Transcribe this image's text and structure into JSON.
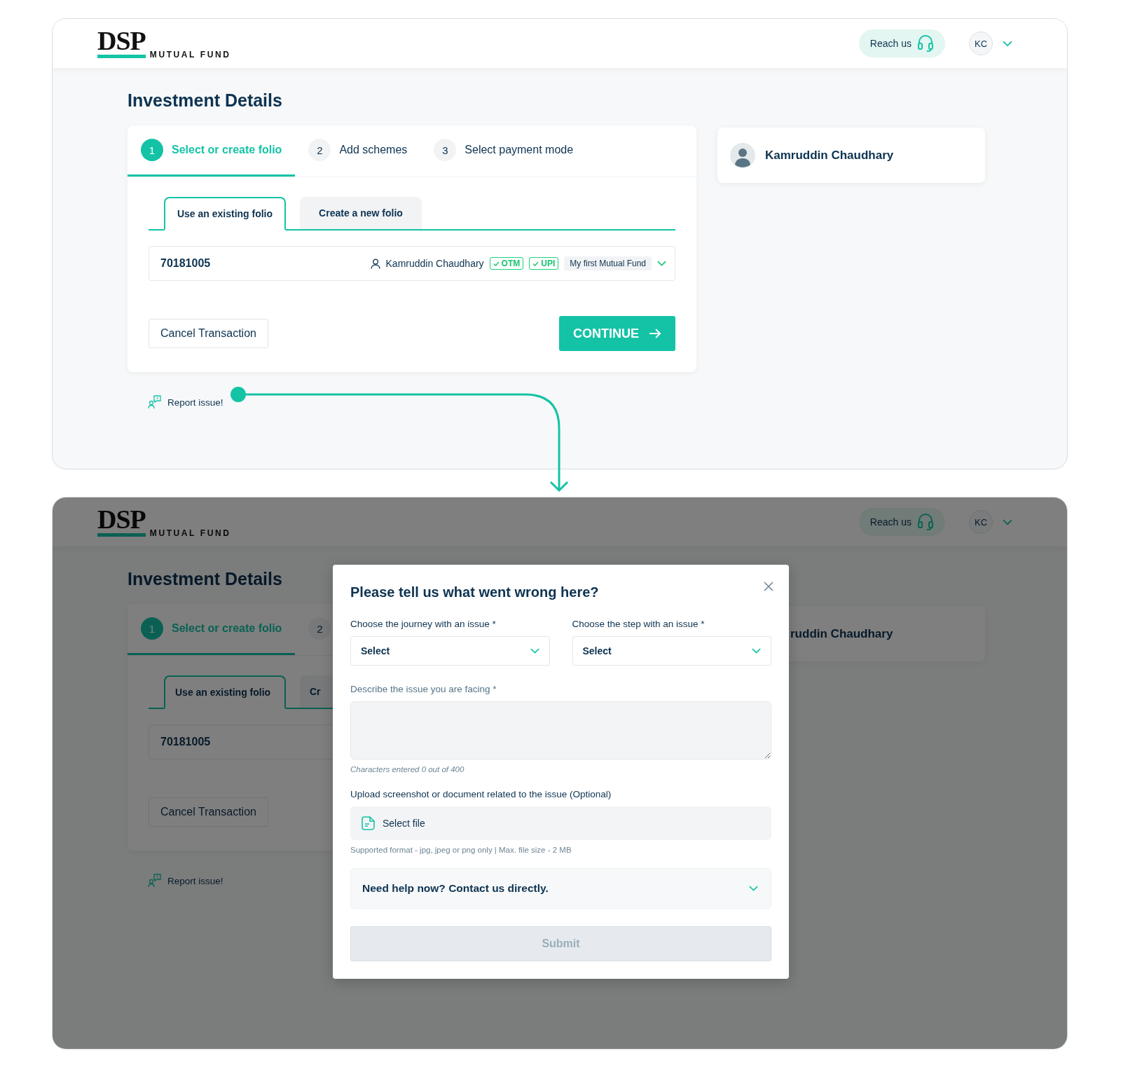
{
  "screens": [
    {
      "kind": "base",
      "header": {
        "logo_mark": "DSP",
        "logo_subtitle": "MUTUAL FUND",
        "reach_us": "Reach us",
        "avatar": "KC"
      },
      "title": "Investment Details",
      "steps": [
        {
          "number": "1",
          "label": "Select or create folio",
          "selected": true
        },
        {
          "number": "2",
          "label": "Add schemes",
          "selected": false
        },
        {
          "number": "3",
          "label": "Select payment mode",
          "selected": false
        }
      ],
      "folio_tabs": [
        {
          "label": "Use an existing folio",
          "selected": true
        },
        {
          "label": "Create a new folio",
          "selected": false
        }
      ],
      "folio": {
        "number": "70181005",
        "holder": "Kamruddin Chaudhary",
        "tags": [
          "OTM",
          "UPI"
        ],
        "name": "My first Mutual Fund"
      },
      "buttons": {
        "cancel": "Cancel Transaction",
        "continue": "CONTINUE"
      },
      "report_issue": "Report issue!",
      "investor": "Kamruddin Chaudhary"
    },
    {
      "kind": "dimmed",
      "header": {
        "logo_mark": "DSP",
        "logo_subtitle": "MUTUAL FUND",
        "reach_us": "Reach us",
        "avatar": "KC"
      },
      "title": "Investment Details",
      "steps": [
        {
          "number": "1",
          "label": "Select or create folio",
          "selected": true
        },
        {
          "number": "2",
          "selected": false
        }
      ],
      "folio_tabs": [
        {
          "label": "Use an existing folio",
          "selected": true
        },
        {
          "label": "Cr",
          "selected": false
        }
      ],
      "folio": {
        "number": "70181005"
      },
      "buttons": {
        "cancel": "Cancel Transaction"
      },
      "report_issue": "Report issue!",
      "investor": "ruddin Chaudhary"
    }
  ],
  "modal": {
    "title": "Please tell us what went wrong here?",
    "fields": [
      {
        "kind": "select",
        "label": "Choose the journey with an issue *",
        "value": "Select"
      },
      {
        "kind": "select",
        "label": "Choose the step with an issue *",
        "value": "Select"
      }
    ],
    "description": {
      "label": "Describe the issue you are facing *",
      "counter": "Characters entered 0 out of 400"
    },
    "upload": {
      "label": "Upload screenshot or document related to the issue (Optional)",
      "button": "Select file",
      "hint": "Supported format - jpg, jpeg or png only | Max. file size - 2 MB"
    },
    "help": {
      "label": "Need help now? Contact us directly.",
      "expanded": false
    },
    "submit": {
      "label": "Submit",
      "disabled": true
    }
  }
}
